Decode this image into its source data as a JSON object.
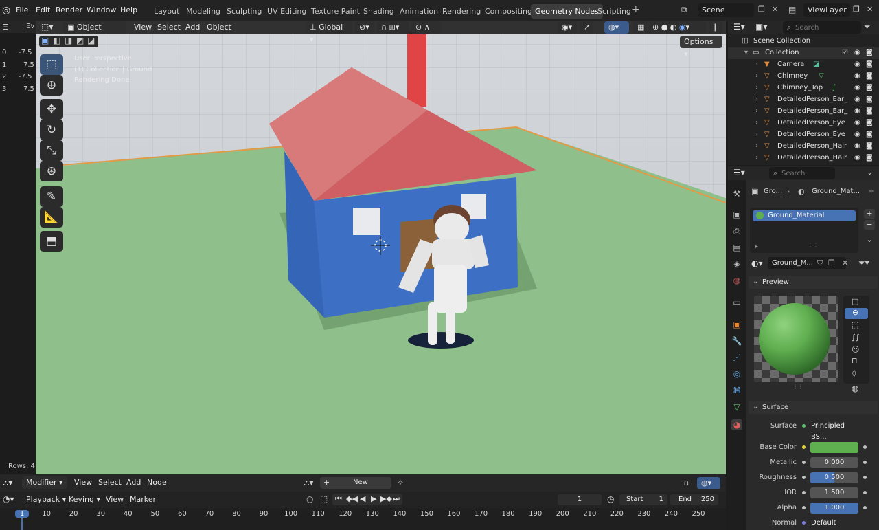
{
  "topbar": {
    "menus": [
      "File",
      "Edit",
      "Render",
      "Window",
      "Help"
    ],
    "workspaces": [
      "Layout",
      "Modeling",
      "Sculpting",
      "UV Editing",
      "Texture Paint",
      "Shading",
      "Animation",
      "Rendering",
      "Compositing",
      "Geometry Nodes",
      "Scripting"
    ],
    "active_workspace": "Geometry Nodes",
    "add_tab": "+",
    "scene": "Scene",
    "view_layer": "ViewLayer"
  },
  "left_strip": {
    "editor_label": "Ev",
    "rows": [
      [
        "0",
        "-7.5"
      ],
      [
        "1",
        "7.5"
      ],
      [
        "2",
        "-7.5"
      ],
      [
        "3",
        "7.5"
      ]
    ],
    "rows_count": "Rows: 4"
  },
  "viewport": {
    "mode": "Object Mode",
    "menus": [
      "View",
      "Select",
      "Add",
      "Object"
    ],
    "orientation": "Global",
    "options": "Options",
    "overlay_lines": [
      "User Perspective",
      "(1) Collection | Ground",
      "Rendering Done"
    ]
  },
  "outliner": {
    "search_placeholder": "Search",
    "scene_collection": "Scene Collection",
    "collection": "Collection",
    "items": [
      "Camera",
      "Chimney",
      "Chimney_Top",
      "DetailedPerson_Ear_",
      "DetailedPerson_Ear_",
      "DetailedPerson_Eye",
      "DetailedPerson_Eye",
      "DetailedPerson_Hair",
      "DetailedPerson_Hair"
    ]
  },
  "properties": {
    "search_placeholder": "Search",
    "breadcrumb_object": "Gro...",
    "breadcrumb_material": "Ground_Mat...",
    "material_slot": "Ground_Material",
    "material_name": "Ground_M...",
    "preview_label": "Preview",
    "surface_section": "Surface",
    "surface_label": "Surface",
    "surface_value": "Principled BS...",
    "fields": [
      {
        "label": "Base Color",
        "value": ""
      },
      {
        "label": "Metallic",
        "value": "0.000"
      },
      {
        "label": "Roughness",
        "value": "0.500"
      },
      {
        "label": "IOR",
        "value": "1.500"
      },
      {
        "label": "Alpha",
        "value": "1.000"
      },
      {
        "label": "Normal",
        "value": "Default"
      }
    ],
    "base_color": "#5fae4f",
    "roughness_fill": 0.5,
    "alpha_fill": 1.0
  },
  "node_editor": {
    "type": "Modifier",
    "menus": [
      "View",
      "Select",
      "Add",
      "Node"
    ],
    "new_button": "New"
  },
  "timeline": {
    "playback": "Playback",
    "keying": "Keying",
    "view": "View",
    "marker": "Marker",
    "current_frame": "1",
    "start_label": "Start",
    "start": "1",
    "end_label": "End",
    "end": "250",
    "ticks": [
      "1",
      "10",
      "20",
      "30",
      "40",
      "50",
      "60",
      "70",
      "80",
      "90",
      "100",
      "110",
      "120",
      "130",
      "140",
      "150",
      "160",
      "170",
      "180",
      "190",
      "200",
      "210",
      "220",
      "230",
      "240",
      "250"
    ]
  },
  "colors": {
    "accent": "#4772b3",
    "ground": "#8fbf8a",
    "house_wall": "#3d6fc4",
    "roof": "#d96a6c",
    "chimney": "#e04444"
  }
}
